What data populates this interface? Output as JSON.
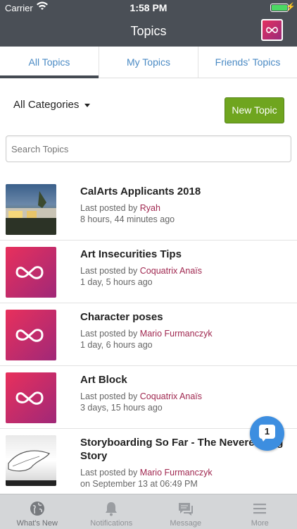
{
  "status": {
    "carrier": "Carrier",
    "time": "1:58 PM"
  },
  "nav": {
    "title": "Topics"
  },
  "tabs": [
    {
      "label": "All Topics",
      "active": true
    },
    {
      "label": "My Topics",
      "active": false
    },
    {
      "label": "Friends' Topics",
      "active": false
    }
  ],
  "filter": {
    "category": "All Categories",
    "new_topic_label": "New Topic"
  },
  "search": {
    "placeholder": "Search Topics"
  },
  "topics": [
    {
      "title": "CalArts Applicants 2018",
      "prefix": "Last posted by ",
      "author": "Ryah",
      "time": "8 hours, 44 minutes ago",
      "thumb": "photo"
    },
    {
      "title": "Art Insecurities Tips",
      "prefix": "Last posted by ",
      "author": "Coquatrix Anaïs",
      "time": "1 day, 5 hours ago",
      "thumb": "logo"
    },
    {
      "title": "Character poses",
      "prefix": "Last posted by ",
      "author": "Mario Furmanczyk",
      "time": "1 day, 6 hours ago",
      "thumb": "logo"
    },
    {
      "title": "Art Block",
      "prefix": "Last posted by ",
      "author": "Coquatrix Anaïs",
      "time": "3 days, 15 hours ago",
      "thumb": "logo"
    },
    {
      "title": "Storyboarding So Far - The Neverending Story",
      "prefix": "Last posted by ",
      "author": "Mario Furmanczyk",
      "time": "on September 13 at 06:49 PM",
      "thumb": "sketch"
    }
  ],
  "chat": {
    "count": "1"
  },
  "bottom": [
    {
      "label": "What's New",
      "icon": "globe-icon"
    },
    {
      "label": "Notifications",
      "icon": "bell-icon"
    },
    {
      "label": "Message",
      "icon": "chat-icon"
    },
    {
      "label": "More",
      "icon": "menu-icon"
    }
  ],
  "colors": {
    "accent": "#4a8ac4",
    "new_topic": "#6fa51f",
    "author": "#a02850",
    "bar": "#4a4f56"
  }
}
